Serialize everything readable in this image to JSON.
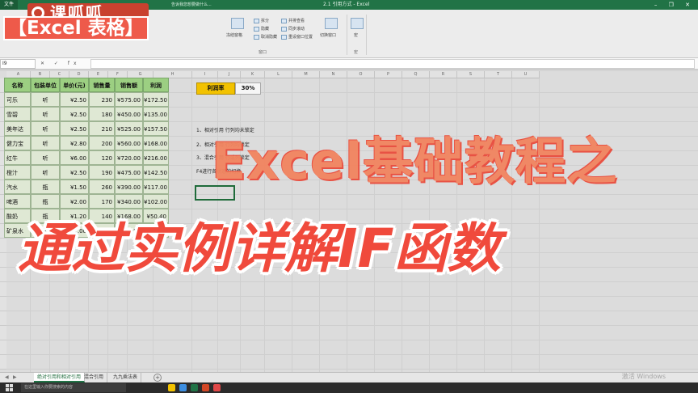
{
  "window": {
    "file_tab": "文件",
    "document_title": "2.1 引用方式 - Excel",
    "tell_me": "告诉我您想要做什么...",
    "controls": "– ❐ ✕"
  },
  "ribbon": {
    "groups": [
      {
        "label": "窗口",
        "buttons": [
          "拆分",
          "隐藏",
          "取消隐藏",
          "并排查看",
          "同步滚动",
          "重设窗口位置",
          "切换窗口"
        ]
      },
      {
        "label": "宏",
        "buttons": [
          "宏"
        ]
      }
    ],
    "freeze_label": "冻结窗格"
  },
  "formula_bar": {
    "name_box": "I9",
    "fx_icons": "✕ ✓ fx",
    "value": ""
  },
  "columns": [
    "A",
    "B",
    "C",
    "D",
    "E",
    "F",
    "G",
    "H",
    "I",
    "J",
    "K",
    "L",
    "M",
    "N",
    "O",
    "P",
    "Q",
    "R",
    "S",
    "T",
    "U"
  ],
  "table": {
    "headers": [
      "名称",
      "包装单位",
      "单价(元)",
      "销售量",
      "销售额",
      "利润"
    ],
    "rows": [
      [
        "可乐",
        "听",
        "¥2.50",
        "230",
        "¥575.00",
        "¥172.50"
      ],
      [
        "雪碧",
        "听",
        "¥2.50",
        "180",
        "¥450.00",
        "¥135.00"
      ],
      [
        "美年达",
        "听",
        "¥2.50",
        "210",
        "¥525.00",
        "¥157.50"
      ],
      [
        "健力宝",
        "听",
        "¥2.80",
        "200",
        "¥560.00",
        "¥168.00"
      ],
      [
        "红牛",
        "听",
        "¥6.00",
        "120",
        "¥720.00",
        "¥216.00"
      ],
      [
        "橙汁",
        "听",
        "¥2.50",
        "190",
        "¥475.00",
        "¥142.50"
      ],
      [
        "汽水",
        "瓶",
        "¥1.50",
        "260",
        "¥390.00",
        "¥117.00"
      ],
      [
        "啤酒",
        "瓶",
        "¥2.00",
        "170",
        "¥340.00",
        "¥102.00"
      ],
      [
        "酸奶",
        "瓶",
        "¥1.20",
        "140",
        "¥168.00",
        "¥50.40"
      ],
      [
        "矿泉水",
        "瓶",
        "¥2.00",
        "260",
        "¥52",
        "¥156.00"
      ]
    ]
  },
  "rate": {
    "label": "利润率",
    "value": "30%"
  },
  "notes": [
    "1、相对引用 行列均未锁定",
    "2、相对引用 行列均锁定",
    "3、混合引用 行或列锁定",
    "F4进行各状态的切换"
  ],
  "sheet_tabs": [
    "绝对引用和相对引用",
    "混合引用",
    "九九乘法表"
  ],
  "taskbar": {
    "search": "在这里输入你要搜索的内容",
    "clock": "激活 Windows"
  },
  "overlay": {
    "logo_text": "课呱呱",
    "tag": "【Excel 表格】",
    "headline_line1": "Excel基础教程之",
    "headline_line2": "通过实例详解IF函数"
  },
  "colors": {
    "excel_green": "#217346",
    "header_green": "#9ccf82",
    "rate_yellow": "#f2c200",
    "headline_red": "#f04a3c"
  }
}
